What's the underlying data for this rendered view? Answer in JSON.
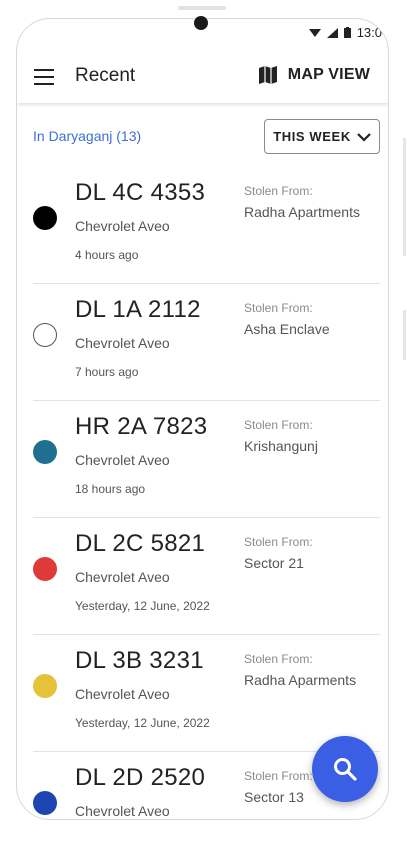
{
  "status": {
    "time": "13:0"
  },
  "appbar": {
    "title": "Recent",
    "map_view_label": "MAP VIEW"
  },
  "filter": {
    "location": "In Daryaganj (13)",
    "period": "THIS WEEK"
  },
  "stolen_from_label": "Stolen From:",
  "vehicles": [
    {
      "plate": "DL 4C 4353",
      "model": "Chevrolet Aveo",
      "time": "4 hours ago",
      "stolen_label": "Stolen From:",
      "location": "Radha Apartments",
      "color": "#000000"
    },
    {
      "plate": "DL 1A 2112",
      "model": "Chevrolet Aveo",
      "time": "7 hours ago",
      "stolen_label": "Stolen From:",
      "location": "Asha Enclave",
      "color": "#ffffff"
    },
    {
      "plate": "HR 2A 7823",
      "model": "Chevrolet Aveo",
      "time": "18 hours ago",
      "stolen_label": "Stolen From:",
      "location": "Krishangunj",
      "color": "#1f6f91"
    },
    {
      "plate": "DL 2C 5821",
      "model": "Chevrolet Aveo",
      "time": "Yesterday, 12 June, 2022",
      "stolen_label": "Stolen From:",
      "location": "Sector 21",
      "color": "#de3a3a"
    },
    {
      "plate": "DL 3B 3231",
      "model": "Chevrolet Aveo",
      "time": "Yesterday, 12 June, 2022",
      "stolen_label": "Stolen From:",
      "location": "Radha Aparments",
      "color": "#e6c23a"
    },
    {
      "plate": "DL 2D 2520",
      "model": "Chevrolet Aveo",
      "time": "",
      "stolen_label": "Stolen From:",
      "location": "Sector 13",
      "color": "#1d47b0"
    }
  ],
  "icons": {
    "menu": "menu-icon",
    "map": "map-icon",
    "chevron": "chevron-down-icon",
    "search": "search-icon"
  },
  "colors": {
    "accent": "#3a5ee4",
    "link": "#3d6fd8"
  }
}
